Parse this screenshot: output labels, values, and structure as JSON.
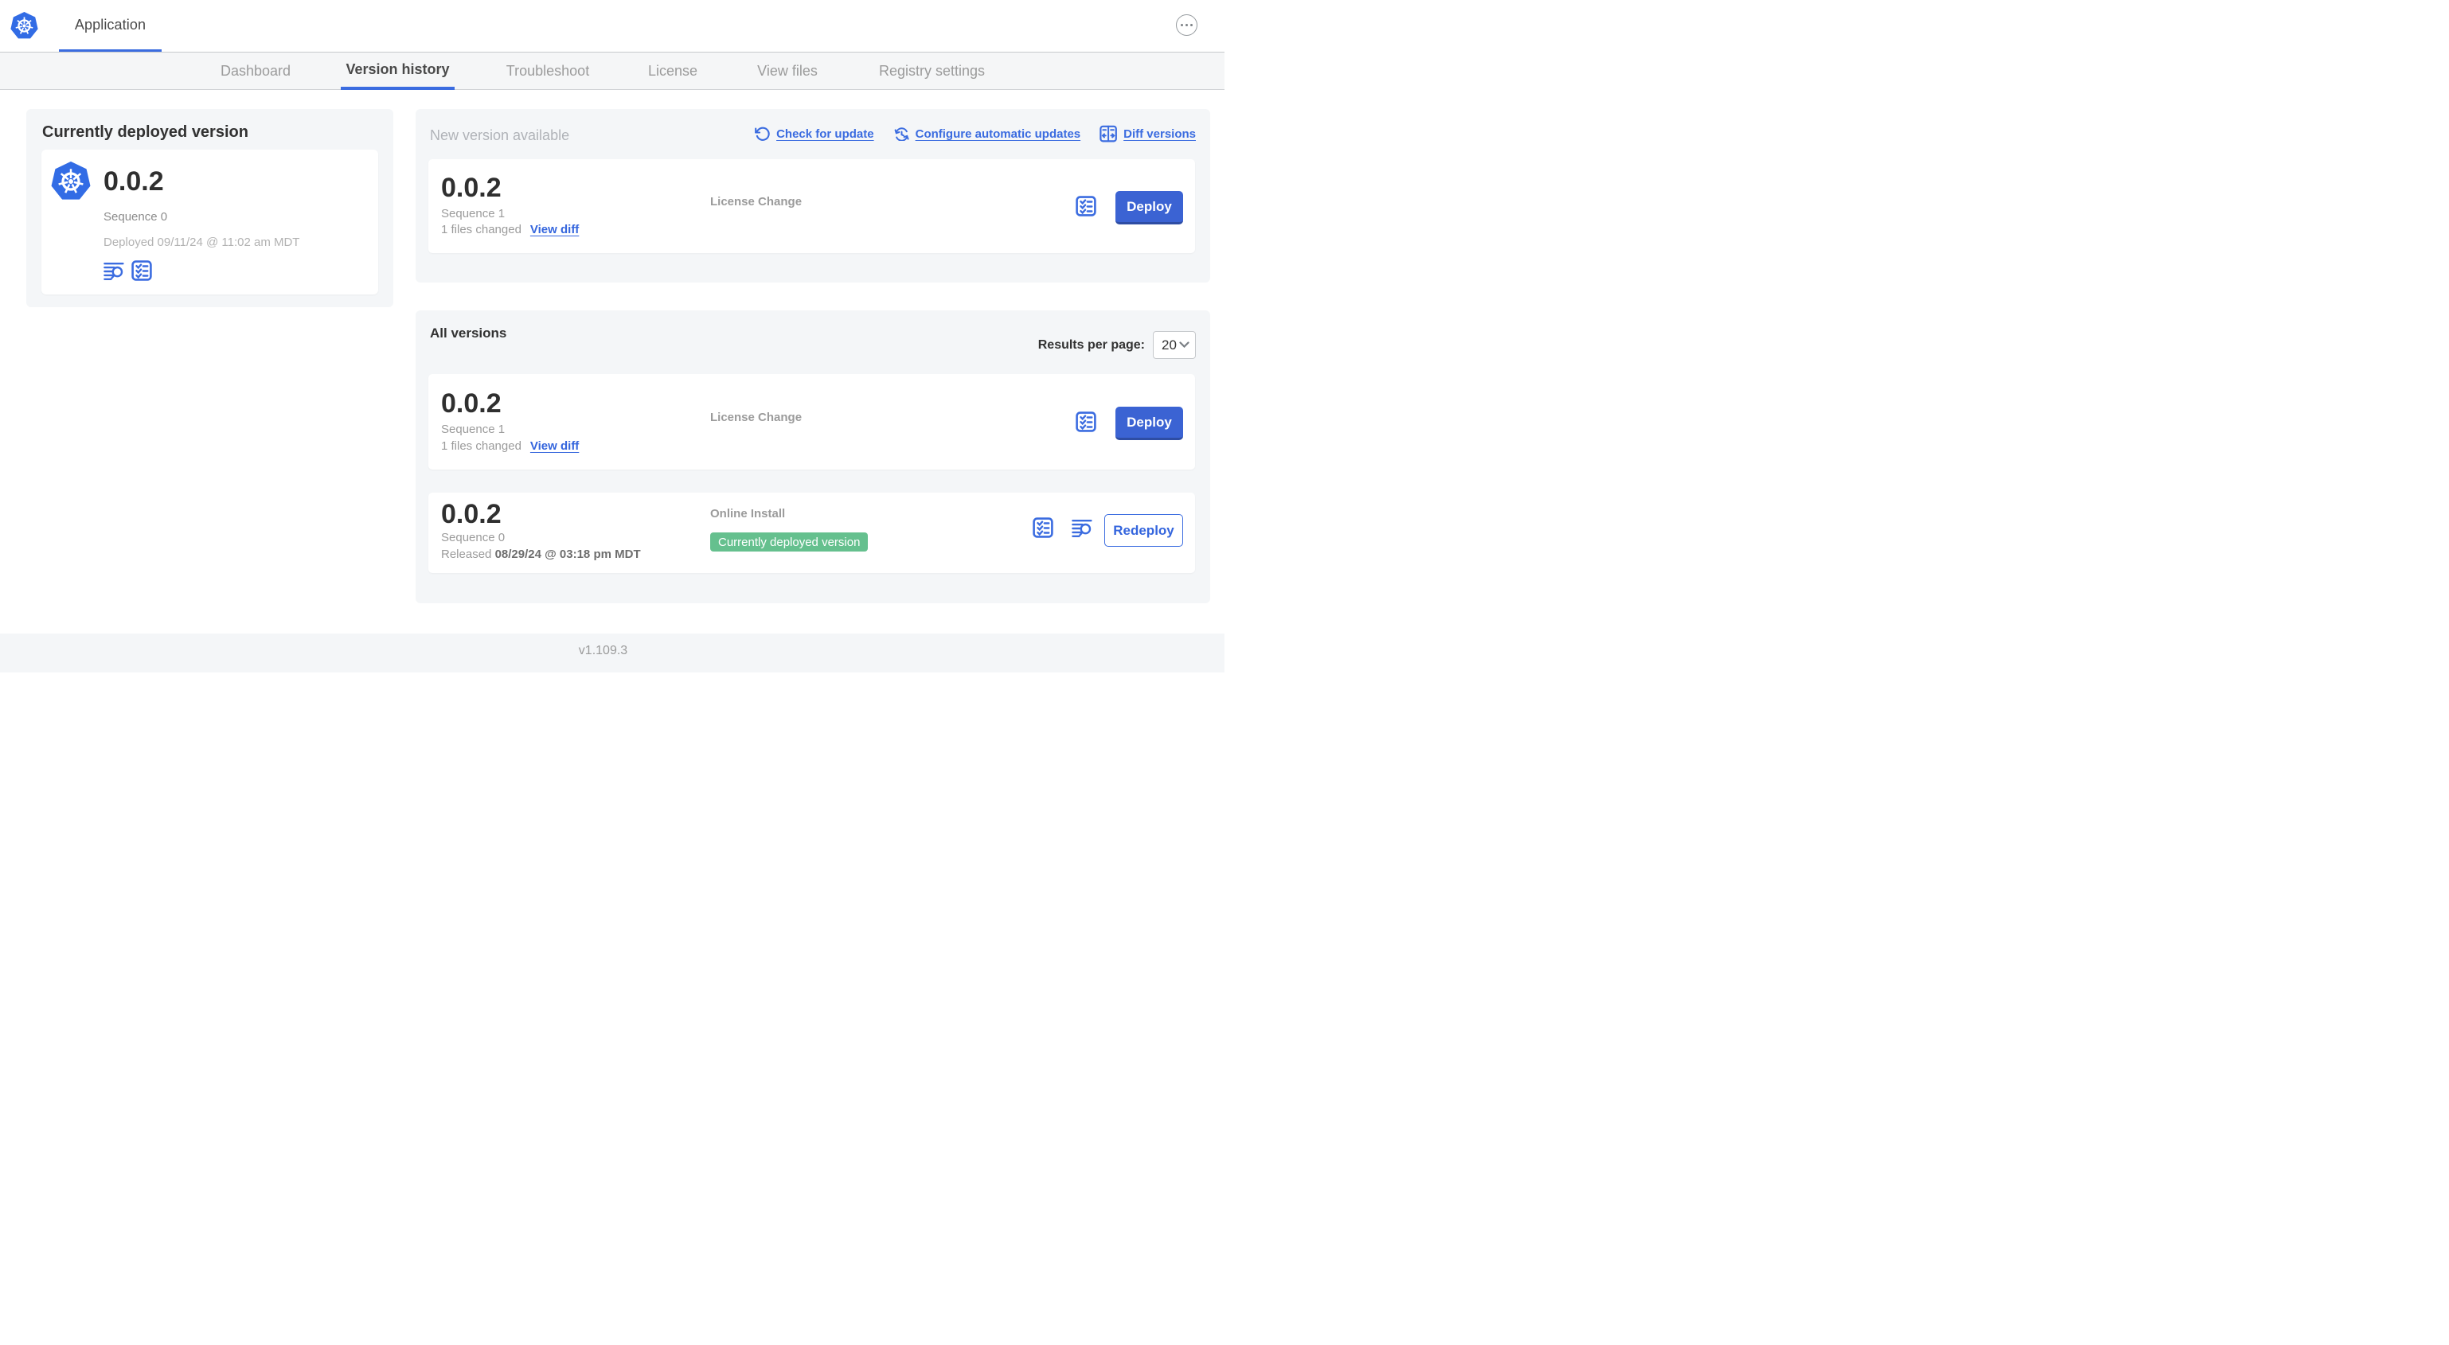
{
  "colors": {
    "accent_blue": "#3b6ce0",
    "kubernetes_blue": "#326ce5",
    "deploy_button_blue": "#3b63d3",
    "badge_green": "#65c08e",
    "panel_gray": "#f4f6f8",
    "dark_text": "#323232",
    "muted_text": "#9b9b9b"
  },
  "header": {
    "app_title": "Application"
  },
  "nav": {
    "tabs": [
      {
        "label": "Dashboard",
        "active": false
      },
      {
        "label": "Version history",
        "active": true
      },
      {
        "label": "Troubleshoot",
        "active": false
      },
      {
        "label": "License",
        "active": false
      },
      {
        "label": "View files",
        "active": false
      },
      {
        "label": "Registry settings",
        "active": false
      }
    ]
  },
  "deployed_panel": {
    "title": "Currently deployed version",
    "version": "0.0.2",
    "sequence": "Sequence 0",
    "deployed": "Deployed 09/11/24 @ 11:02 am MDT"
  },
  "new_version_panel": {
    "title": "New version available",
    "links": {
      "check": "Check for update",
      "configure": "Configure automatic updates",
      "diff": "Diff versions"
    },
    "card": {
      "version": "0.0.2",
      "sequence": "Sequence 1",
      "files_changed": "1 files changed",
      "view_diff": "View diff",
      "source": "License Change",
      "action": "Deploy"
    }
  },
  "all_versions_panel": {
    "title": "All versions",
    "results_label": "Results per page:",
    "page_size": "20",
    "cards": [
      {
        "version": "0.0.2",
        "sequence": "Sequence 1",
        "files_changed": "1 files changed",
        "view_diff": "View diff",
        "source": "License Change",
        "action": "Deploy"
      },
      {
        "version": "0.0.2",
        "sequence": "Sequence 0",
        "released_label": "Released",
        "released_date": "08/29/24 @ 03:18 pm MDT",
        "source": "Online Install",
        "badge": "Currently deployed version",
        "action": "Redeploy"
      }
    ]
  },
  "footer": {
    "version": "v1.109.3"
  }
}
